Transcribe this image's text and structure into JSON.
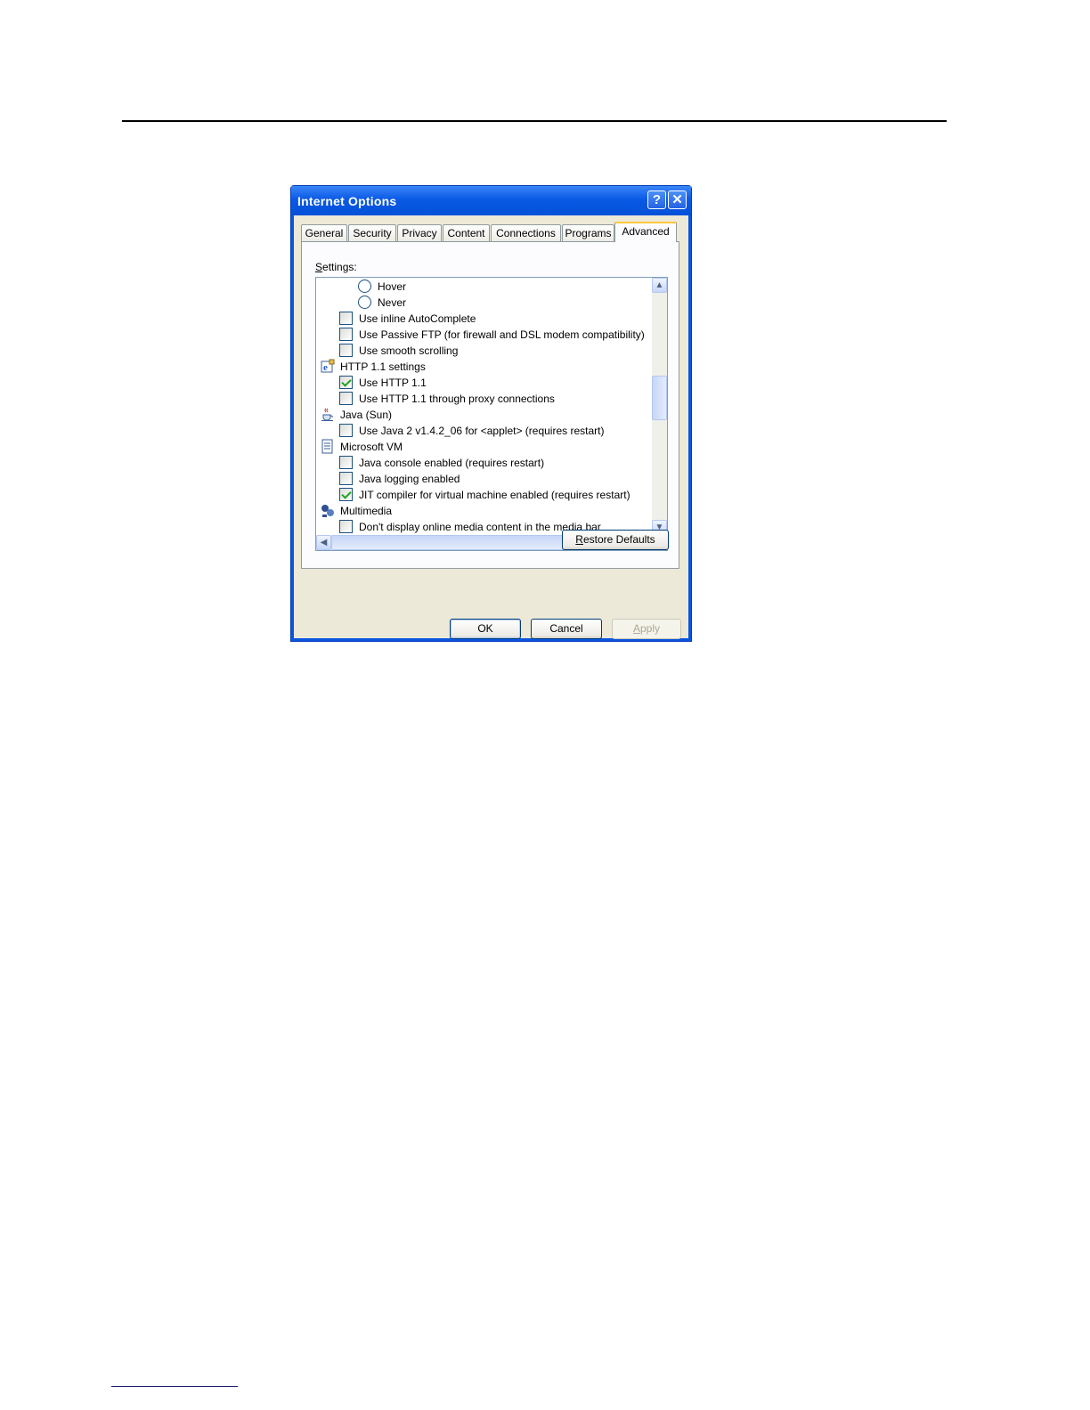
{
  "window": {
    "title": "Internet Options",
    "help_glyph": "?",
    "close_glyph": "✕"
  },
  "tabs": [
    {
      "label": "General"
    },
    {
      "label": "Security"
    },
    {
      "label": "Privacy"
    },
    {
      "label": "Content"
    },
    {
      "label": "Connections"
    },
    {
      "label": "Programs"
    },
    {
      "label": "Advanced",
      "active": true
    }
  ],
  "settings": {
    "label_prefix": "S",
    "label_rest": "ettings:",
    "items": [
      {
        "kind": "radio",
        "label": "Hover",
        "checked": false
      },
      {
        "kind": "radio",
        "label": "Never",
        "checked": false
      },
      {
        "kind": "checkbox",
        "label": "Use inline AutoComplete",
        "checked": false
      },
      {
        "kind": "checkbox",
        "label": "Use Passive FTP (for firewall and DSL modem compatibility)",
        "checked": false
      },
      {
        "kind": "checkbox",
        "label": "Use smooth scrolling",
        "checked": false
      },
      {
        "kind": "category",
        "label": "HTTP 1.1 settings",
        "icon": "ie-settings-icon"
      },
      {
        "kind": "checkbox",
        "label": "Use HTTP 1.1",
        "checked": true
      },
      {
        "kind": "checkbox",
        "label": "Use HTTP 1.1 through proxy connections",
        "checked": false
      },
      {
        "kind": "category",
        "label": "Java (Sun)",
        "icon": "java-cup-icon"
      },
      {
        "kind": "checkbox",
        "label": "Use Java 2 v1.4.2_06 for <applet> (requires restart)",
        "checked": false
      },
      {
        "kind": "category",
        "label": "Microsoft VM",
        "icon": "document-icon"
      },
      {
        "kind": "checkbox",
        "label": "Java console enabled (requires restart)",
        "checked": false
      },
      {
        "kind": "checkbox",
        "label": "Java logging enabled",
        "checked": false
      },
      {
        "kind": "checkbox",
        "label": "JIT compiler for virtual machine enabled (requires restart)",
        "checked": true
      },
      {
        "kind": "category",
        "label": "Multimedia",
        "icon": "multimedia-icon"
      },
      {
        "kind": "checkbox",
        "label": "Don't display online media content in the media bar",
        "checked": false
      }
    ]
  },
  "buttons": {
    "restore_prefix": "R",
    "restore_rest": "estore Defaults",
    "ok": "OK",
    "cancel": "Cancel",
    "apply_prefix": "A",
    "apply_rest": "pply"
  },
  "scrollbar": {
    "up": "▲",
    "down": "▼",
    "left": "◀",
    "right": "▶"
  }
}
